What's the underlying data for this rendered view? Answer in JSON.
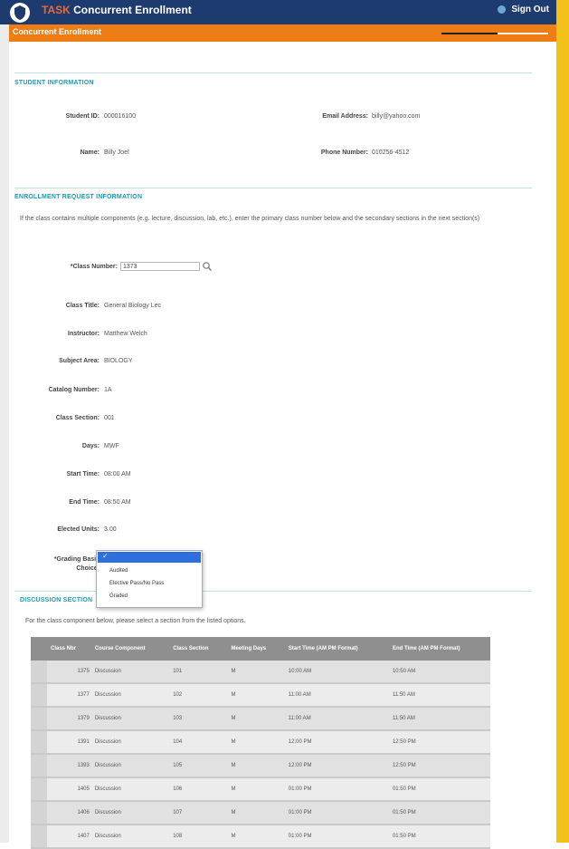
{
  "header": {
    "brand": "TASK",
    "title": "Concurrent Enrollment",
    "sign_out": "Sign Out"
  },
  "subheader": {
    "title": "Concurrent Enrollment"
  },
  "student_info": {
    "section_title": "STUDENT INFORMATION",
    "student_id_label": "Student ID:",
    "student_id": "000016100",
    "name_label": "Name:",
    "name": "Billy Joel",
    "email_label": "Email Address:",
    "email": "billy@yahoo.com",
    "phone_label": "Phone Number:",
    "phone": "010256-4512"
  },
  "enrollment_request": {
    "section_title": "ENROLLMENT REQUEST INFORMATION",
    "instruction": "If the class contains multiple components (e.g. lecture, discussion, lab, etc.), enter the primary class number below and the secondary sections in the next section(s)",
    "class_number_label": "*Class Number:",
    "class_number": "1373",
    "class_title_label": "Class Title:",
    "class_title": "General Biology Lec",
    "instructor_label": "Instructor:",
    "instructor": "Matthew Welch",
    "subject_area_label": "Subject Area:",
    "subject_area": "BIOLOGY",
    "catalog_number_label": "Catalog Number:",
    "catalog_number": "1A",
    "class_section_label": "Class Section:",
    "class_section": "001",
    "days_label": "Days:",
    "days": "MWF",
    "start_time_label": "Start Time:",
    "start_time": "08:00 AM",
    "end_time_label": "End Time:",
    "end_time": "08:50 AM",
    "elected_units_label": "Elected Units:",
    "elected_units": "3.00",
    "grading_basis_label_1": "*Grading Basis",
    "grading_basis_label_2": "Choice:",
    "grading_options": [
      "Audited",
      "Elective Pass/No Pass",
      "Graded"
    ]
  },
  "discussion": {
    "section_title": "DISCUSSION SECTION",
    "instruction": "For the class component below, please select a section from the listed options.",
    "columns": [
      "Class Nbr",
      "Course Component",
      "Class Section",
      "Meeting Days",
      "Start Time (AM PM Format)",
      "End Time (AM PM Format)"
    ],
    "rows": [
      [
        "1375",
        "Discussion",
        "101",
        "M",
        "10:00 AM",
        "10:50 AM"
      ],
      [
        "1377",
        "Discussion",
        "102",
        "M",
        "11:00 AM",
        "11:50 AM"
      ],
      [
        "1379",
        "Discussion",
        "103",
        "M",
        "11:00 AM",
        "11:50 AM"
      ],
      [
        "1391",
        "Discussion",
        "104",
        "M",
        "12:00 PM",
        "12:50 PM"
      ],
      [
        "1393",
        "Discussion",
        "105",
        "M",
        "12:00 PM",
        "12:50 PM"
      ],
      [
        "1405",
        "Discussion",
        "106",
        "M",
        "01:00 PM",
        "01:50 PM"
      ],
      [
        "1406",
        "Discussion",
        "107",
        "M",
        "01:00 PM",
        "01:50 PM"
      ],
      [
        "1407",
        "Discussion",
        "108",
        "M",
        "01:00 PM",
        "01:50 PM"
      ]
    ]
  },
  "colors": {
    "header_bg": "#1d3b6e",
    "subheader_bg": "#ee7d16",
    "section_title": "#1a9bb6",
    "right_stripe": "#f2c21b",
    "dropdown_highlight": "#2f6fdd"
  }
}
